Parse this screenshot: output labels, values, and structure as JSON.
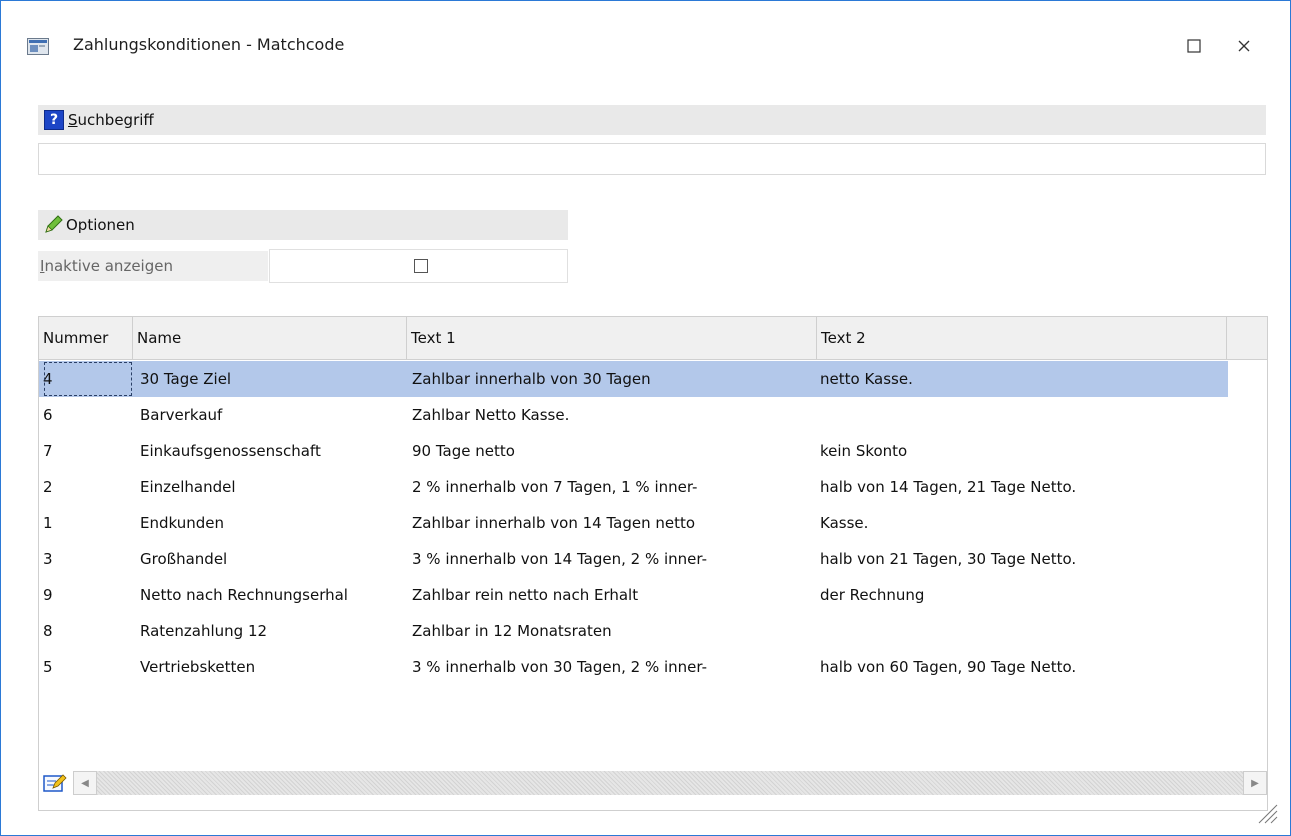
{
  "window": {
    "title": "Zahlungskonditionen - Matchcode",
    "accent_color": "#2b79d6"
  },
  "search": {
    "section_label": "Suchbegriff",
    "value": "",
    "placeholder": ""
  },
  "options": {
    "section_label": "Optionen",
    "inactive_label": "Inaktive anzeigen",
    "inactive_checked": false
  },
  "table": {
    "columns": [
      "Nummer",
      "Name",
      "Text 1",
      "Text 2"
    ],
    "selected_row_index": 0,
    "selection_color": "#b3c8ea",
    "rows": [
      [
        "4",
        "30 Tage Ziel",
        "Zahlbar innerhalb von 30 Tagen",
        "netto Kasse."
      ],
      [
        "6",
        "Barverkauf",
        "Zahlbar Netto Kasse.",
        ""
      ],
      [
        "7",
        "Einkaufsgenossenschaft",
        "90 Tage netto",
        "kein Skonto"
      ],
      [
        "2",
        "Einzelhandel",
        "2 % innerhalb von 7 Tagen, 1 % inner-",
        "halb von 14 Tagen, 21 Tage Netto."
      ],
      [
        "1",
        "Endkunden",
        "Zahlbar innerhalb von 14 Tagen netto",
        "Kasse."
      ],
      [
        "3",
        "Großhandel",
        "3 % innerhalb von 14 Tagen, 2 % inner-",
        "halb von 21 Tagen, 30 Tage Netto."
      ],
      [
        "9",
        "Netto nach Rechnungserhal",
        "Zahlbar rein netto nach Erhalt",
        "der Rechnung"
      ],
      [
        "8",
        "Ratenzahlung 12",
        "Zahlbar in 12 Monatsraten",
        ""
      ],
      [
        "5",
        "Vertriebsketten",
        "3 % innerhalb von 30 Tagen, 2 % inner-",
        "halb von 60 Tagen, 90 Tage Netto."
      ]
    ]
  },
  "icons": {
    "app": "app-window-icon",
    "maximize": "maximize-icon",
    "close": "close-icon",
    "help": "help-icon",
    "options": "pencil-icon",
    "edit": "edit-icon",
    "scroll_left": "scroll-left-icon",
    "scroll_right": "scroll-right-icon",
    "resize": "resize-grip-icon"
  }
}
